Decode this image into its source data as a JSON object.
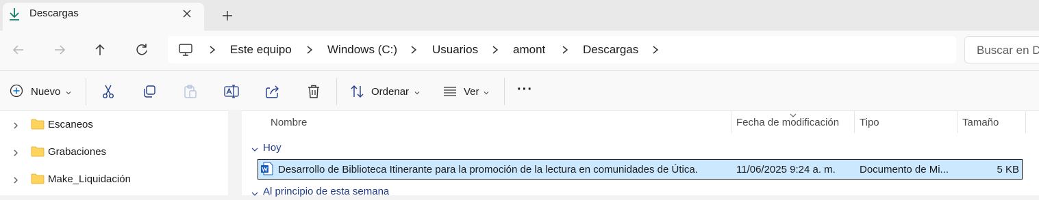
{
  "tab": {
    "title": "Descargas"
  },
  "breadcrumb": [
    "Este equipo",
    "Windows (C:)",
    "Usuarios",
    "amont",
    "Descargas"
  ],
  "search": {
    "placeholder": "Buscar en D"
  },
  "commands": {
    "new_label": "Nuevo",
    "sort_label": "Ordenar",
    "view_label": "Ver",
    "more_label": "···"
  },
  "sidebar": {
    "items": [
      {
        "label": "Escaneos"
      },
      {
        "label": "Grabaciones"
      },
      {
        "label": "Make_Liquidación"
      }
    ]
  },
  "columns": {
    "name": "Nombre",
    "modified": "Fecha de modificación",
    "type": "Tipo",
    "size": "Tamaño"
  },
  "groups": {
    "today": "Hoy",
    "this_week": "Al principio de esta semana"
  },
  "files": [
    {
      "name": "Desarrollo de Biblioteca Itinerante para la promoción de la lectura en comunidades de Útica.",
      "modified": "11/06/2025 9:24 a. m.",
      "type": "Documento de Mi...",
      "size": "5 KB",
      "icon": "word-document-icon"
    }
  ],
  "colors": {
    "accent": "#0067c0",
    "selection": "#cce8ff",
    "group_text": "#1f3c8a",
    "word_blue": "#185abd"
  }
}
